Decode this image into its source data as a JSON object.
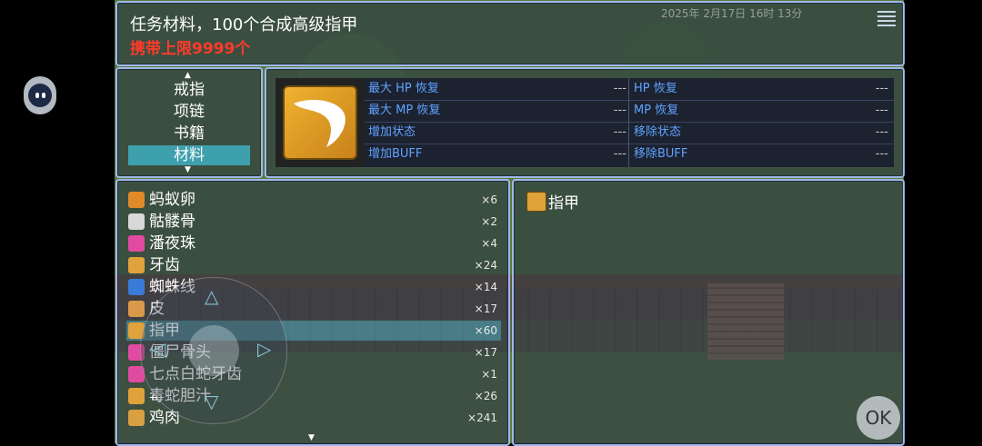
{
  "help": {
    "description": "任务材料，100个合成高级指甲",
    "limit": "携带上限9999个",
    "clock": "2025年 2月17日 16时 13分"
  },
  "categories": [
    {
      "label": "戒指",
      "selected": false
    },
    {
      "label": "项链",
      "selected": false
    },
    {
      "label": "书籍",
      "selected": false
    },
    {
      "label": "材料",
      "selected": true
    }
  ],
  "detail": {
    "icon": "claw-icon",
    "rows": [
      {
        "left": "最大 HP 恢复",
        "left_val": "---",
        "right": "HP 恢复",
        "right_val": "---"
      },
      {
        "left": "最大 MP 恢复",
        "left_val": "---",
        "right": "MP 恢复",
        "right_val": "---"
      },
      {
        "left": "增加状态",
        "left_val": "---",
        "right": "移除状态",
        "right_val": "---"
      },
      {
        "left": "增加BUFF",
        "left_val": "---",
        "right": "移除BUFF",
        "right_val": "---"
      }
    ]
  },
  "items": [
    {
      "name": "蚂蚁卵",
      "qty": "×6",
      "icon": "ant-egg-icon",
      "color": "#e08a2a",
      "selected": false
    },
    {
      "name": "骷髅骨",
      "qty": "×2",
      "icon": "skull-icon",
      "color": "#d8d8d8",
      "selected": false
    },
    {
      "name": "潘夜珠",
      "qty": "×4",
      "icon": "pearl-icon",
      "color": "#e04aa0",
      "selected": false
    },
    {
      "name": "牙齿",
      "qty": "×24",
      "icon": "tooth-icon",
      "color": "#e0a23a",
      "selected": false
    },
    {
      "name": "蜘蛛线",
      "qty": "×14",
      "icon": "spider-web-icon",
      "color": "#3a7ad8",
      "selected": false
    },
    {
      "name": "皮",
      "qty": "×17",
      "icon": "hide-icon",
      "color": "#d89a4a",
      "selected": false
    },
    {
      "name": "指甲",
      "qty": "×60",
      "icon": "claw-icon",
      "color": "#e0a23a",
      "selected": true
    },
    {
      "name": "僵尸骨头",
      "qty": "×17",
      "icon": "zombie-bone-icon",
      "color": "#e04aa0",
      "selected": false
    },
    {
      "name": "七点白蛇牙齿",
      "qty": "×1",
      "icon": "snake-fang-icon",
      "color": "#e04aa0",
      "selected": false
    },
    {
      "name": "毒蛇胆汁",
      "qty": "×26",
      "icon": "venom-icon",
      "color": "#e0a23a",
      "selected": false
    },
    {
      "name": "鸡肉",
      "qty": "×241",
      "icon": "chicken-icon",
      "color": "#d8a040",
      "selected": false
    }
  ],
  "result": {
    "name": "指甲",
    "icon": "claw-icon"
  },
  "buttons": {
    "ok": "OK"
  }
}
